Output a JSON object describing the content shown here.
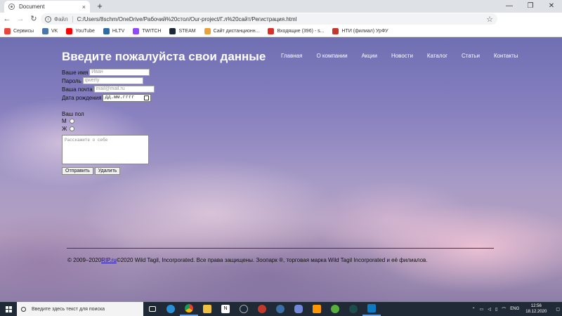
{
  "browser": {
    "tab_title": "Document",
    "tab_close": "×",
    "new_tab": "+",
    "window_buttons": [
      "—",
      "❐",
      "✕"
    ],
    "url_scheme": "Файл",
    "url": "C:/Users/8schm/OneDrive/Рабочий%20стол/Our-project/Г.л%20сайт/Регистрация.html",
    "bookmarks": [
      {
        "label": "Сервисы",
        "color": "#e8453c"
      },
      {
        "label": "VK",
        "color": "#4a76a8"
      },
      {
        "label": "YouTube",
        "color": "#ff0000"
      },
      {
        "label": "HLTV",
        "color": "#2d6da3"
      },
      {
        "label": "TWITCH",
        "color": "#9146ff"
      },
      {
        "label": "STEAM",
        "color": "#1b2838"
      },
      {
        "label": "Сайт дистанционн...",
        "color": "#e8a13c"
      },
      {
        "label": "Входящие (396) - s...",
        "color": "#d93025"
      },
      {
        "label": "НТИ (филиал) УрФУ",
        "color": "#c0392b"
      }
    ]
  },
  "page": {
    "title": "Введите пожалуйста свои данные",
    "nav": [
      "Главная",
      "О компании",
      "Акции",
      "Новости",
      "Каталог",
      "Статьи",
      "Контакты"
    ],
    "form": {
      "name_label": "Ваше имя",
      "name_placeholder": "Иван",
      "password_label": "Пароль",
      "password_placeholder": "qwerty",
      "email_label": "Ваша почта",
      "email_placeholder": "mail@mail.ru",
      "birth_label": "Дата рождения",
      "birth_placeholder": "дд.мм.гггг",
      "gender_label": "Ваш пол",
      "gender_m": "М",
      "gender_f": "Ж",
      "about_placeholder": "Расскажите о себе",
      "submit_label": "Отправить",
      "delete_label": "Удалить"
    },
    "footer": {
      "prefix": "© 2009–2020",
      "link": "RIP.ru",
      "suffix": "©2020 Wild Tagil, Incorporated. Все права защищены. Зоопарк ®, торговая марка Wild Tagil Incorporated и её филиалов."
    }
  },
  "taskbar": {
    "search_placeholder": "Введите здесь текст для поиска",
    "lang": "ENG",
    "time": "12:56",
    "date": "18.12.2020"
  }
}
